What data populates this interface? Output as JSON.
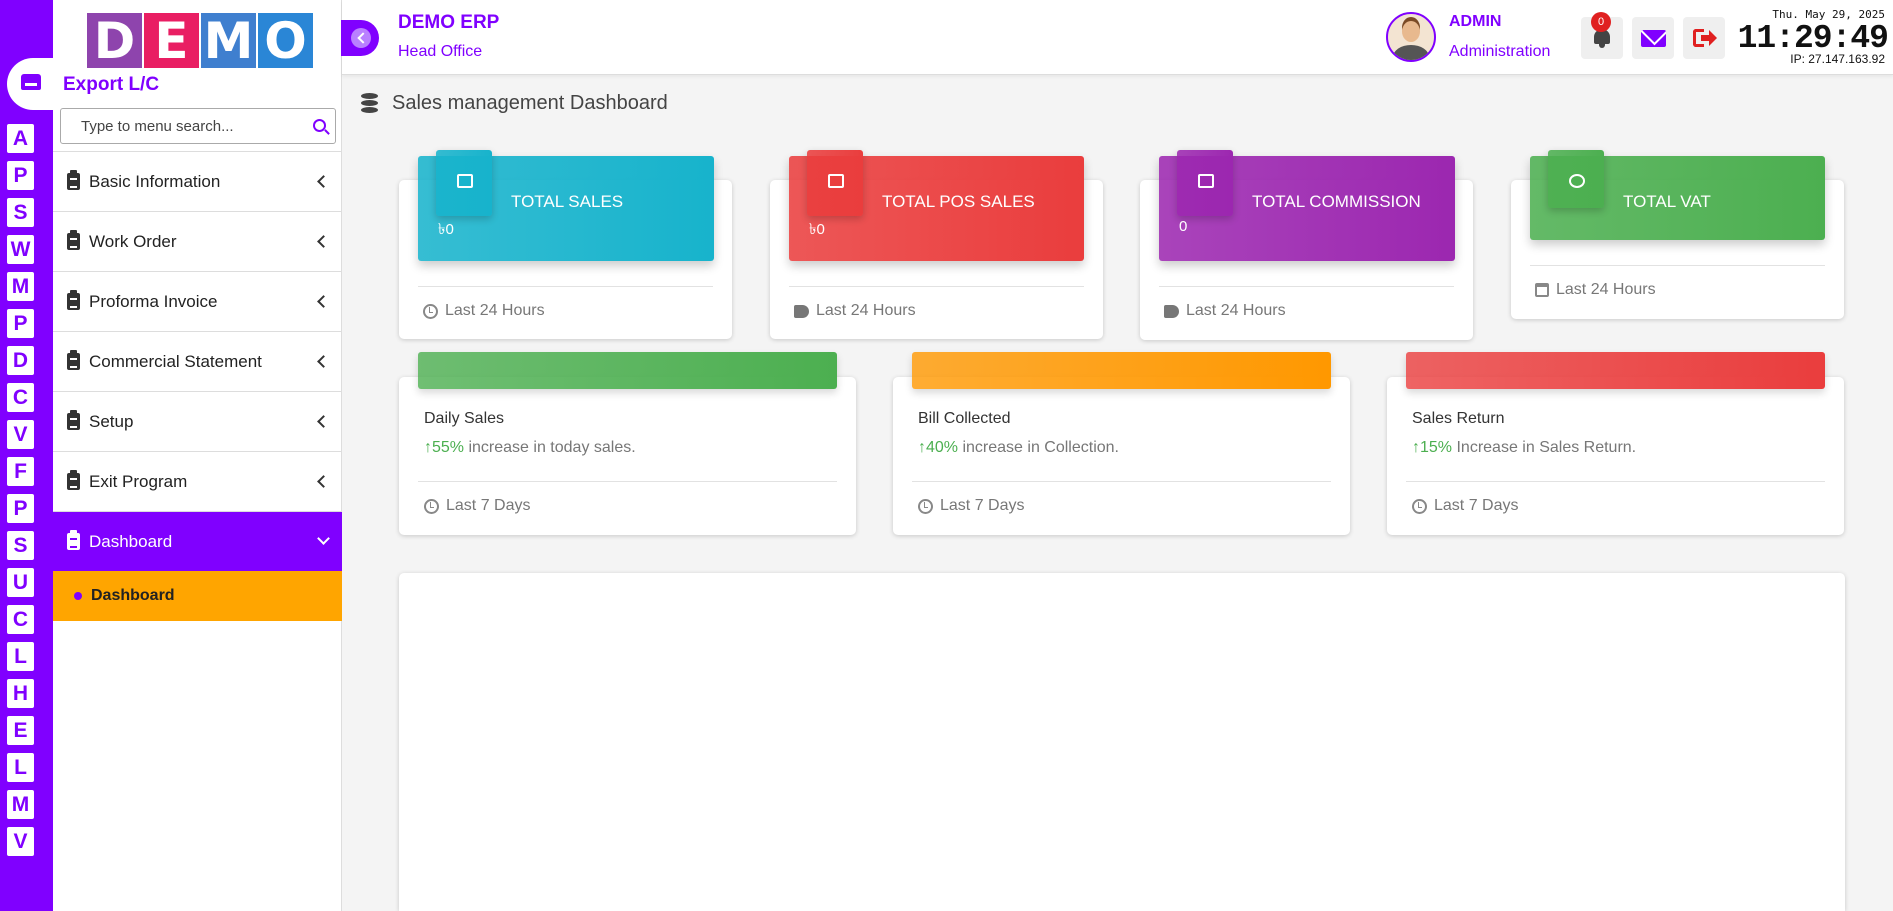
{
  "rail": {
    "letters": [
      "A",
      "P",
      "S",
      "W",
      "M",
      "P",
      "D",
      "C",
      "V",
      "F",
      "P",
      "S",
      "U",
      "C",
      "L",
      "H",
      "E",
      "L",
      "M",
      "V"
    ]
  },
  "sidebar": {
    "logo_letters": [
      "D",
      "E",
      "M",
      "O"
    ],
    "logo_colors": [
      "#8e44ad",
      "#e91e63",
      "#3f7fcf",
      "#2a86d6"
    ],
    "module_title": "Export L/C",
    "search_placeholder": "Type to menu search...",
    "menu": [
      {
        "label": "Basic Information"
      },
      {
        "label": "Work Order"
      },
      {
        "label": "Proforma Invoice"
      },
      {
        "label": "Commercial Statement"
      },
      {
        "label": "Setup"
      },
      {
        "label": "Exit Program"
      }
    ],
    "active_menu": {
      "label": "Dashboard"
    },
    "active_sub": {
      "label": "Dashboard"
    }
  },
  "header": {
    "app_name": "DEMO ERP",
    "branch": "Head Office",
    "user_name": "ADMIN",
    "user_role": "Administration",
    "notifications": "0",
    "date": "Thu. May 29, 2025",
    "time": "11:29:49",
    "ip": "IP: 27.147.163.92"
  },
  "page": {
    "title": "Sales management Dashboard"
  },
  "stats": [
    {
      "title": "TOTAL SALES",
      "value": "৳0",
      "footer": "Last 24 Hours",
      "color": "#17b3cc"
    },
    {
      "title": "TOTAL POS SALES",
      "value": "৳0",
      "footer": "Last 24 Hours",
      "color": "#ea3d3d"
    },
    {
      "title": "TOTAL COMMISSION",
      "value": "0",
      "footer": "Last 24 Hours",
      "color": "#9c27b0"
    },
    {
      "title": "TOTAL VAT",
      "value": "",
      "footer": "Last 24 Hours",
      "color": "#4caf50"
    }
  ],
  "summaries": [
    {
      "title": "Daily Sales",
      "pct": "55%",
      "text": " increase in today sales.",
      "footer": "Last 7 Days",
      "color": "#4caf50"
    },
    {
      "title": "Bill Collected",
      "pct": "40%",
      "text": " increase in Collection.",
      "footer": "Last 7 Days",
      "color": "#ff9800"
    },
    {
      "title": "Sales Return",
      "pct": "15%",
      "text": " Increase in Sales Return.",
      "footer": "Last 7 Days",
      "color": "#ea3d3d"
    }
  ]
}
